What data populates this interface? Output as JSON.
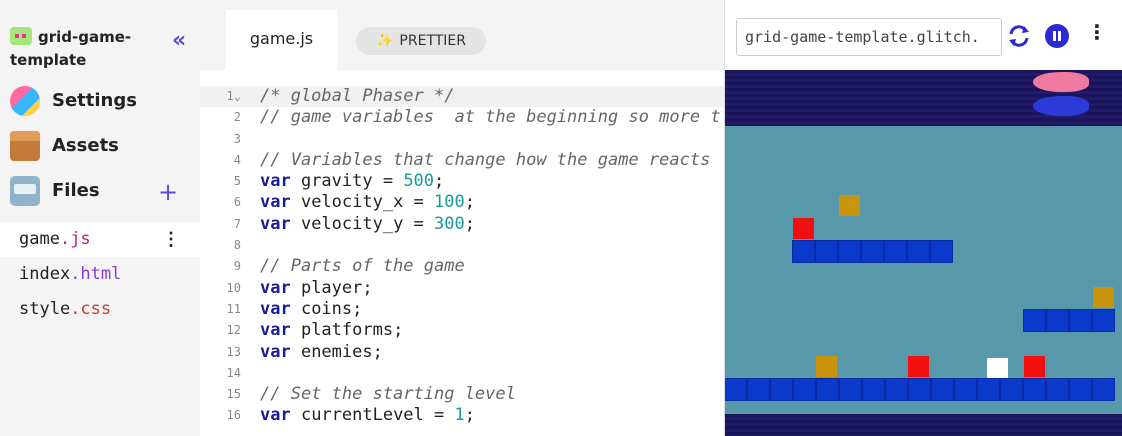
{
  "sidebar": {
    "project_name": "grid-game-template",
    "nav": [
      {
        "label": "Settings",
        "icon": "settings-icon"
      },
      {
        "label": "Assets",
        "icon": "assets-icon"
      },
      {
        "label": "Files",
        "icon": "files-icon"
      }
    ],
    "files": [
      {
        "base": "game",
        "ext": ".js"
      },
      {
        "base": "index",
        "ext": ".html"
      },
      {
        "base": "style",
        "ext": ".css"
      }
    ]
  },
  "editor": {
    "tab_label": "game.js",
    "prettier_label": "PRETTIER",
    "lines": [
      {
        "n": "1",
        "text": "/* global Phaser */"
      },
      {
        "n": "2",
        "text": "// game variables  at the beginning so more t"
      },
      {
        "n": "3",
        "text": ""
      },
      {
        "n": "4",
        "text": "// Variables that change how the game reacts"
      },
      {
        "n": "5",
        "text": "var gravity = 500;"
      },
      {
        "n": "6",
        "text": "var velocity_x = 100;"
      },
      {
        "n": "7",
        "text": "var velocity_y = 300;"
      },
      {
        "n": "8",
        "text": ""
      },
      {
        "n": "9",
        "text": "// Parts of the game"
      },
      {
        "n": "10",
        "text": "var player;"
      },
      {
        "n": "11",
        "text": "var coins;"
      },
      {
        "n": "12",
        "text": "var platforms;"
      },
      {
        "n": "13",
        "text": "var enemies;"
      },
      {
        "n": "14",
        "text": ""
      },
      {
        "n": "15",
        "text": "// Set the starting level"
      },
      {
        "n": "16",
        "text": "var currentLevel = 1;"
      }
    ]
  },
  "preview": {
    "url": "grid-game-template.glitch."
  },
  "colors": {
    "accent": "#5a4bd8",
    "keyword": "#1a1f8f",
    "number": "#1a9a9a",
    "game_bg": "#5798ab"
  }
}
